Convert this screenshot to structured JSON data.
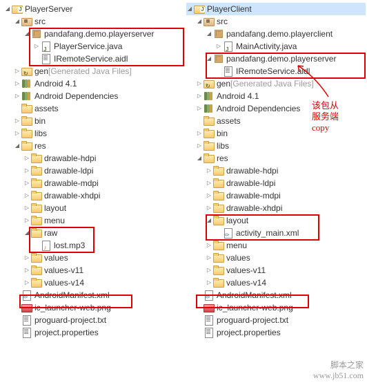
{
  "left": {
    "title": "PlayerServer",
    "src": "src",
    "pkg": "pandafang.demo.playerserver",
    "svc": "PlayerService.java",
    "aidl": "IRemoteService.aidl",
    "gen": "gen",
    "genNote": "[Generated Java Files]",
    "android": "Android 4.1",
    "deps": "Android Dependencies",
    "assets": "assets",
    "bin": "bin",
    "libs": "libs",
    "res": "res",
    "hdpi": "drawable-hdpi",
    "ldpi": "drawable-ldpi",
    "mdpi": "drawable-mdpi",
    "xhdpi": "drawable-xhdpi",
    "layout": "layout",
    "menu": "menu",
    "raw": "raw",
    "mp3": "lost.mp3",
    "values": "values",
    "v11": "values-v11",
    "v14": "values-v14",
    "manifest": "AndroidManifest.xml",
    "iclaunch": "ic_launcher-web.png",
    "proguard": "proguard-project.txt",
    "projprop": "project.properties"
  },
  "right": {
    "title": "PlayerClient",
    "src": "src",
    "pkgClient": "pandafang.demo.playerclient",
    "main": "MainActivity.java",
    "pkgServer": "pandafang.demo.playerserver",
    "aidl": "IRemoteService.aidl",
    "gen": "gen",
    "genNote": "[Generated Java Files]",
    "android": "Android 4.1",
    "deps": "Android Dependencies",
    "assets": "assets",
    "bin": "bin",
    "libs": "libs",
    "res": "res",
    "hdpi": "drawable-hdpi",
    "ldpi": "drawable-ldpi",
    "mdpi": "drawable-mdpi",
    "xhdpi": "drawable-xhdpi",
    "layout": "layout",
    "actxml": "activity_main.xml",
    "menu": "menu",
    "values": "values",
    "v11": "values-v11",
    "v14": "values-v14",
    "manifest": "AndroidManifest.xml",
    "iclaunch": "ic_launcher-web.png",
    "proguard": "proguard-project.txt",
    "projprop": "project.properties"
  },
  "annotation": {
    "line1": "该包从",
    "line2": "服务端",
    "line3": "copy"
  },
  "watermark": "脚本之家\nwww.jb51.com"
}
